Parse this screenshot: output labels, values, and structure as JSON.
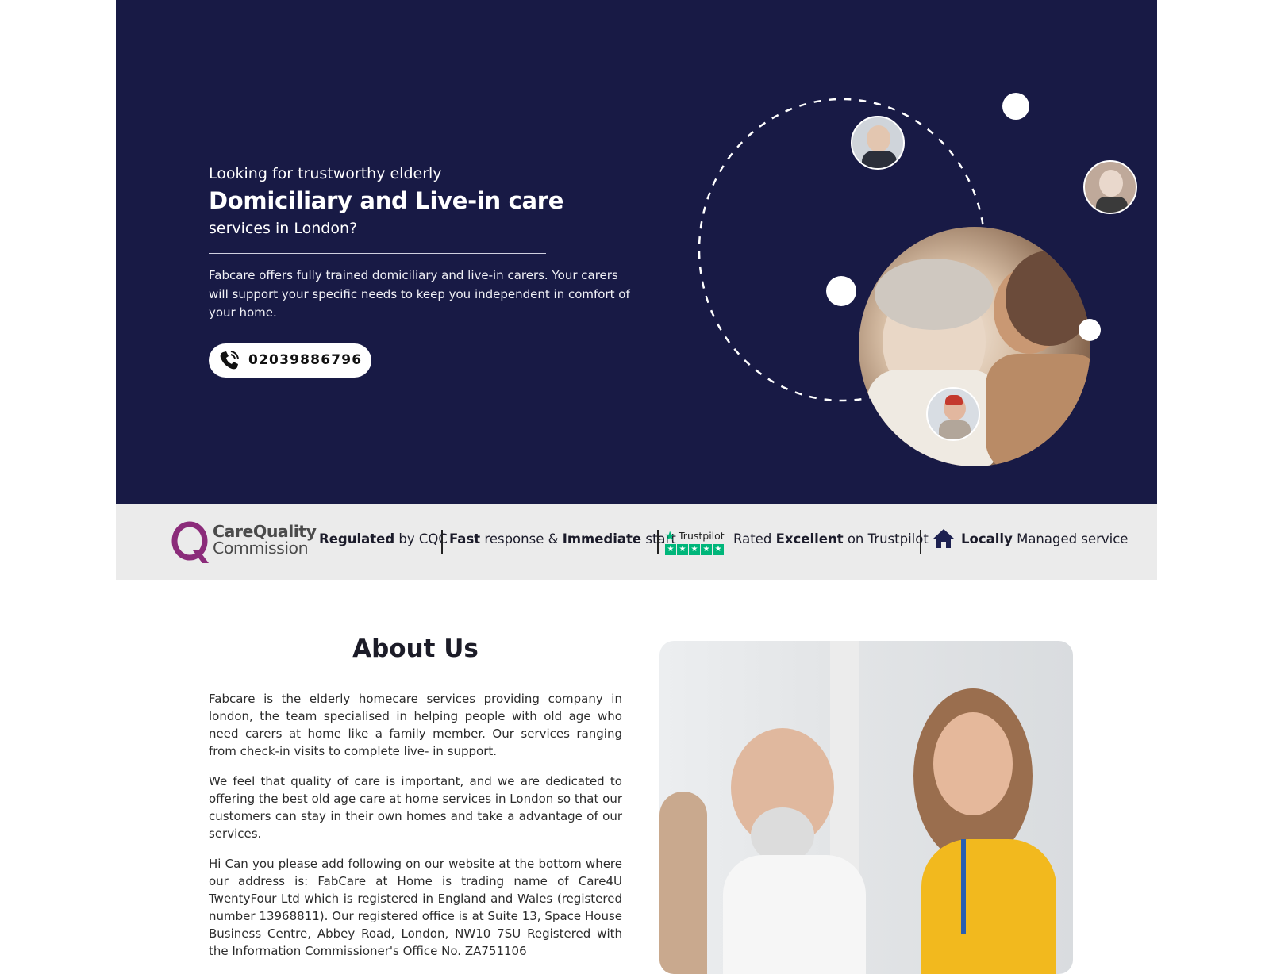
{
  "hero": {
    "lead": "Looking for trustworthy elderly",
    "title": "Domiciliary and Live-in care",
    "subtitle": "services in London?",
    "description": "Fabcare offers fully trained domiciliary and live-in carers. Your carers will support your specific needs to keep you independent in comfort of your home.",
    "phone": "02039886796"
  },
  "trustbar": {
    "cqc_line1": "CareQuality",
    "cqc_line2": "Commission",
    "regulated_bold": "Regulated",
    "regulated_rest": " by CQC",
    "fast_bold": "Fast",
    "fast_mid": " response & ",
    "immediate_bold": "Immediate",
    "fast_rest": " start",
    "trustpilot_label": "Trustpilot",
    "rated_pre": "Rated ",
    "rated_bold": "Excellent",
    "rated_post": " on Trustpilot",
    "locally_bold": "Locally",
    "locally_rest": " Managed service"
  },
  "about": {
    "title": "About Us",
    "p1": "Fabcare is the elderly homecare services providing company in london, the team specialised in helping people with old age who need carers at home like a family member. Our services ranging from check-in visits to complete live- in support.",
    "p2": "We feel that quality of care is important, and we are dedicated to offering the best old age care at home services in London so that our customers can stay in their own homes and take a advantage of our services.",
    "p3": "Hi Can you please add following on our website at the bottom where our address is: FabCare at Home is trading name of Care4U TwentyFour Ltd which is registered in England and Wales (registered number 13968811). Our registered office is at Suite 13, Space House Business Centre, Abbey Road, London, NW10 7SU Registered with the Information Commissioner's Office No. ZA751106"
  },
  "colors": {
    "hero_bg": "#181a45",
    "trustbar_bg": "#ebebeb",
    "cqc_purple": "#8b2b7a",
    "trustpilot_green": "#00b67a"
  }
}
